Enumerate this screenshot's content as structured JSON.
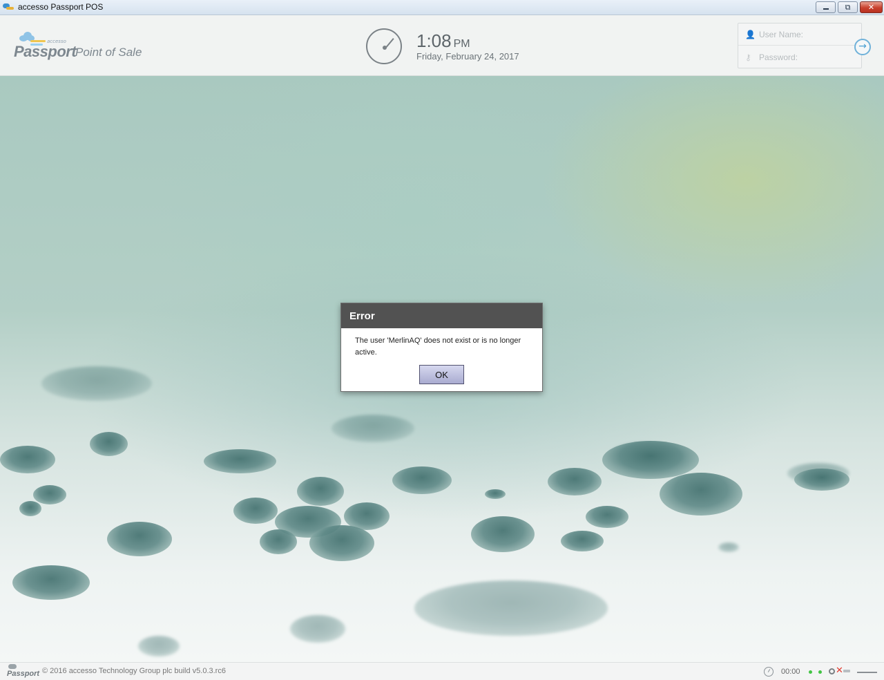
{
  "window": {
    "title": "accesso Passport POS",
    "controls": {
      "minimize": "",
      "maximize": "⧉",
      "close": "✕"
    }
  },
  "header": {
    "logo": {
      "small": "accesso",
      "brand": "Passport",
      "product": "Point of Sale"
    },
    "clock": {
      "time": "1:08",
      "ampm": "PM",
      "date": "Friday, February 24, 2017"
    },
    "login": {
      "username_placeholder": "User Name:",
      "username_value": "",
      "password_placeholder": "Password:",
      "password_value": "",
      "user_icon": "user-icon",
      "password_icon": "key-icon",
      "submit_icon": "arrow-right-circle-icon"
    }
  },
  "dialog": {
    "title": "Error",
    "message": "The user 'MerlinAQ' does not exist or is no longer active.",
    "ok_label": "OK"
  },
  "footer": {
    "logo": "Passport",
    "copyright": "© 2016 accesso Technology Group plc build v5.0.3.rc6",
    "timer": "00:00",
    "status_colors": {
      "ok": "#43c445",
      "error": "#e03a2f"
    }
  }
}
